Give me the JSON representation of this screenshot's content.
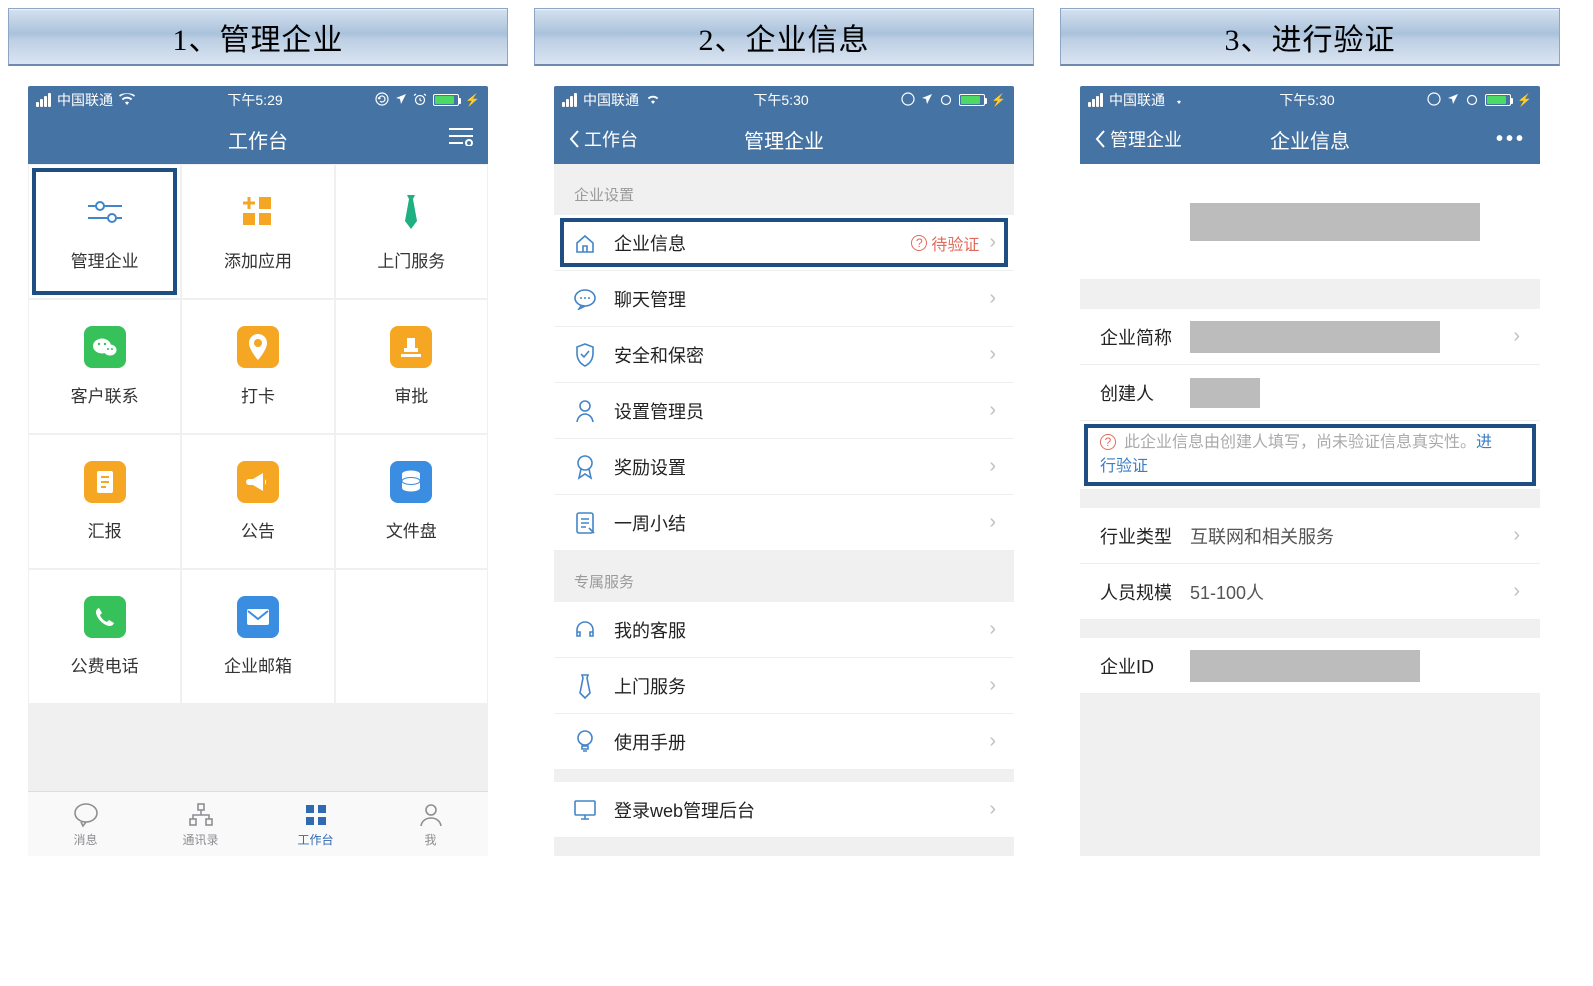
{
  "steps": {
    "s1_title": "1、管理企业",
    "s2_title": "2、企业信息",
    "s3_title": "3、进行验证"
  },
  "statusbar": {
    "carrier": "中国联通",
    "time1": "下午5:29",
    "time2": "下午5:30",
    "time3": "下午5:30"
  },
  "panel1": {
    "nav_title": "工作台",
    "apps": {
      "manage_enterprise": "管理企业",
      "add_app": "添加应用",
      "onsite_service": "上门服务",
      "customer_contact": "客户联系",
      "clock_in": "打卡",
      "approval": "审批",
      "report": "汇报",
      "announcement": "公告",
      "filedisk": "文件盘",
      "free_call": "公费电话",
      "enterprise_mail": "企业邮箱"
    },
    "tabs": {
      "messages": "消息",
      "contacts": "通讯录",
      "workbench": "工作台",
      "me": "我"
    }
  },
  "panel2": {
    "back_label": "工作台",
    "nav_title": "管理企业",
    "section_settings": "企业设置",
    "section_services": "专属服务",
    "items": {
      "enterprise_info": "企业信息",
      "pending": "待验证",
      "chat_manage": "聊天管理",
      "security": "安全和保密",
      "admin_setup": "设置管理员",
      "reward_settings": "奖励设置",
      "weekly_summary": "一周小结",
      "my_customer_service": "我的客服",
      "onsite_service": "上门服务",
      "user_manual": "使用手册",
      "web_admin": "登录web管理后台"
    }
  },
  "panel3": {
    "back_label": "管理企业",
    "nav_title": "企业信息",
    "rows": {
      "short_name": "企业简称",
      "creator": "创建人",
      "notice_text": "此企业信息由创建人填写，尚未验证信息真实性。",
      "verify_link": "进行验证",
      "industry": "行业类型",
      "industry_val": "互联网和相关服务",
      "staff_scale": "人员规模",
      "staff_scale_val": "51-100人",
      "enterprise_id": "企业ID"
    }
  }
}
